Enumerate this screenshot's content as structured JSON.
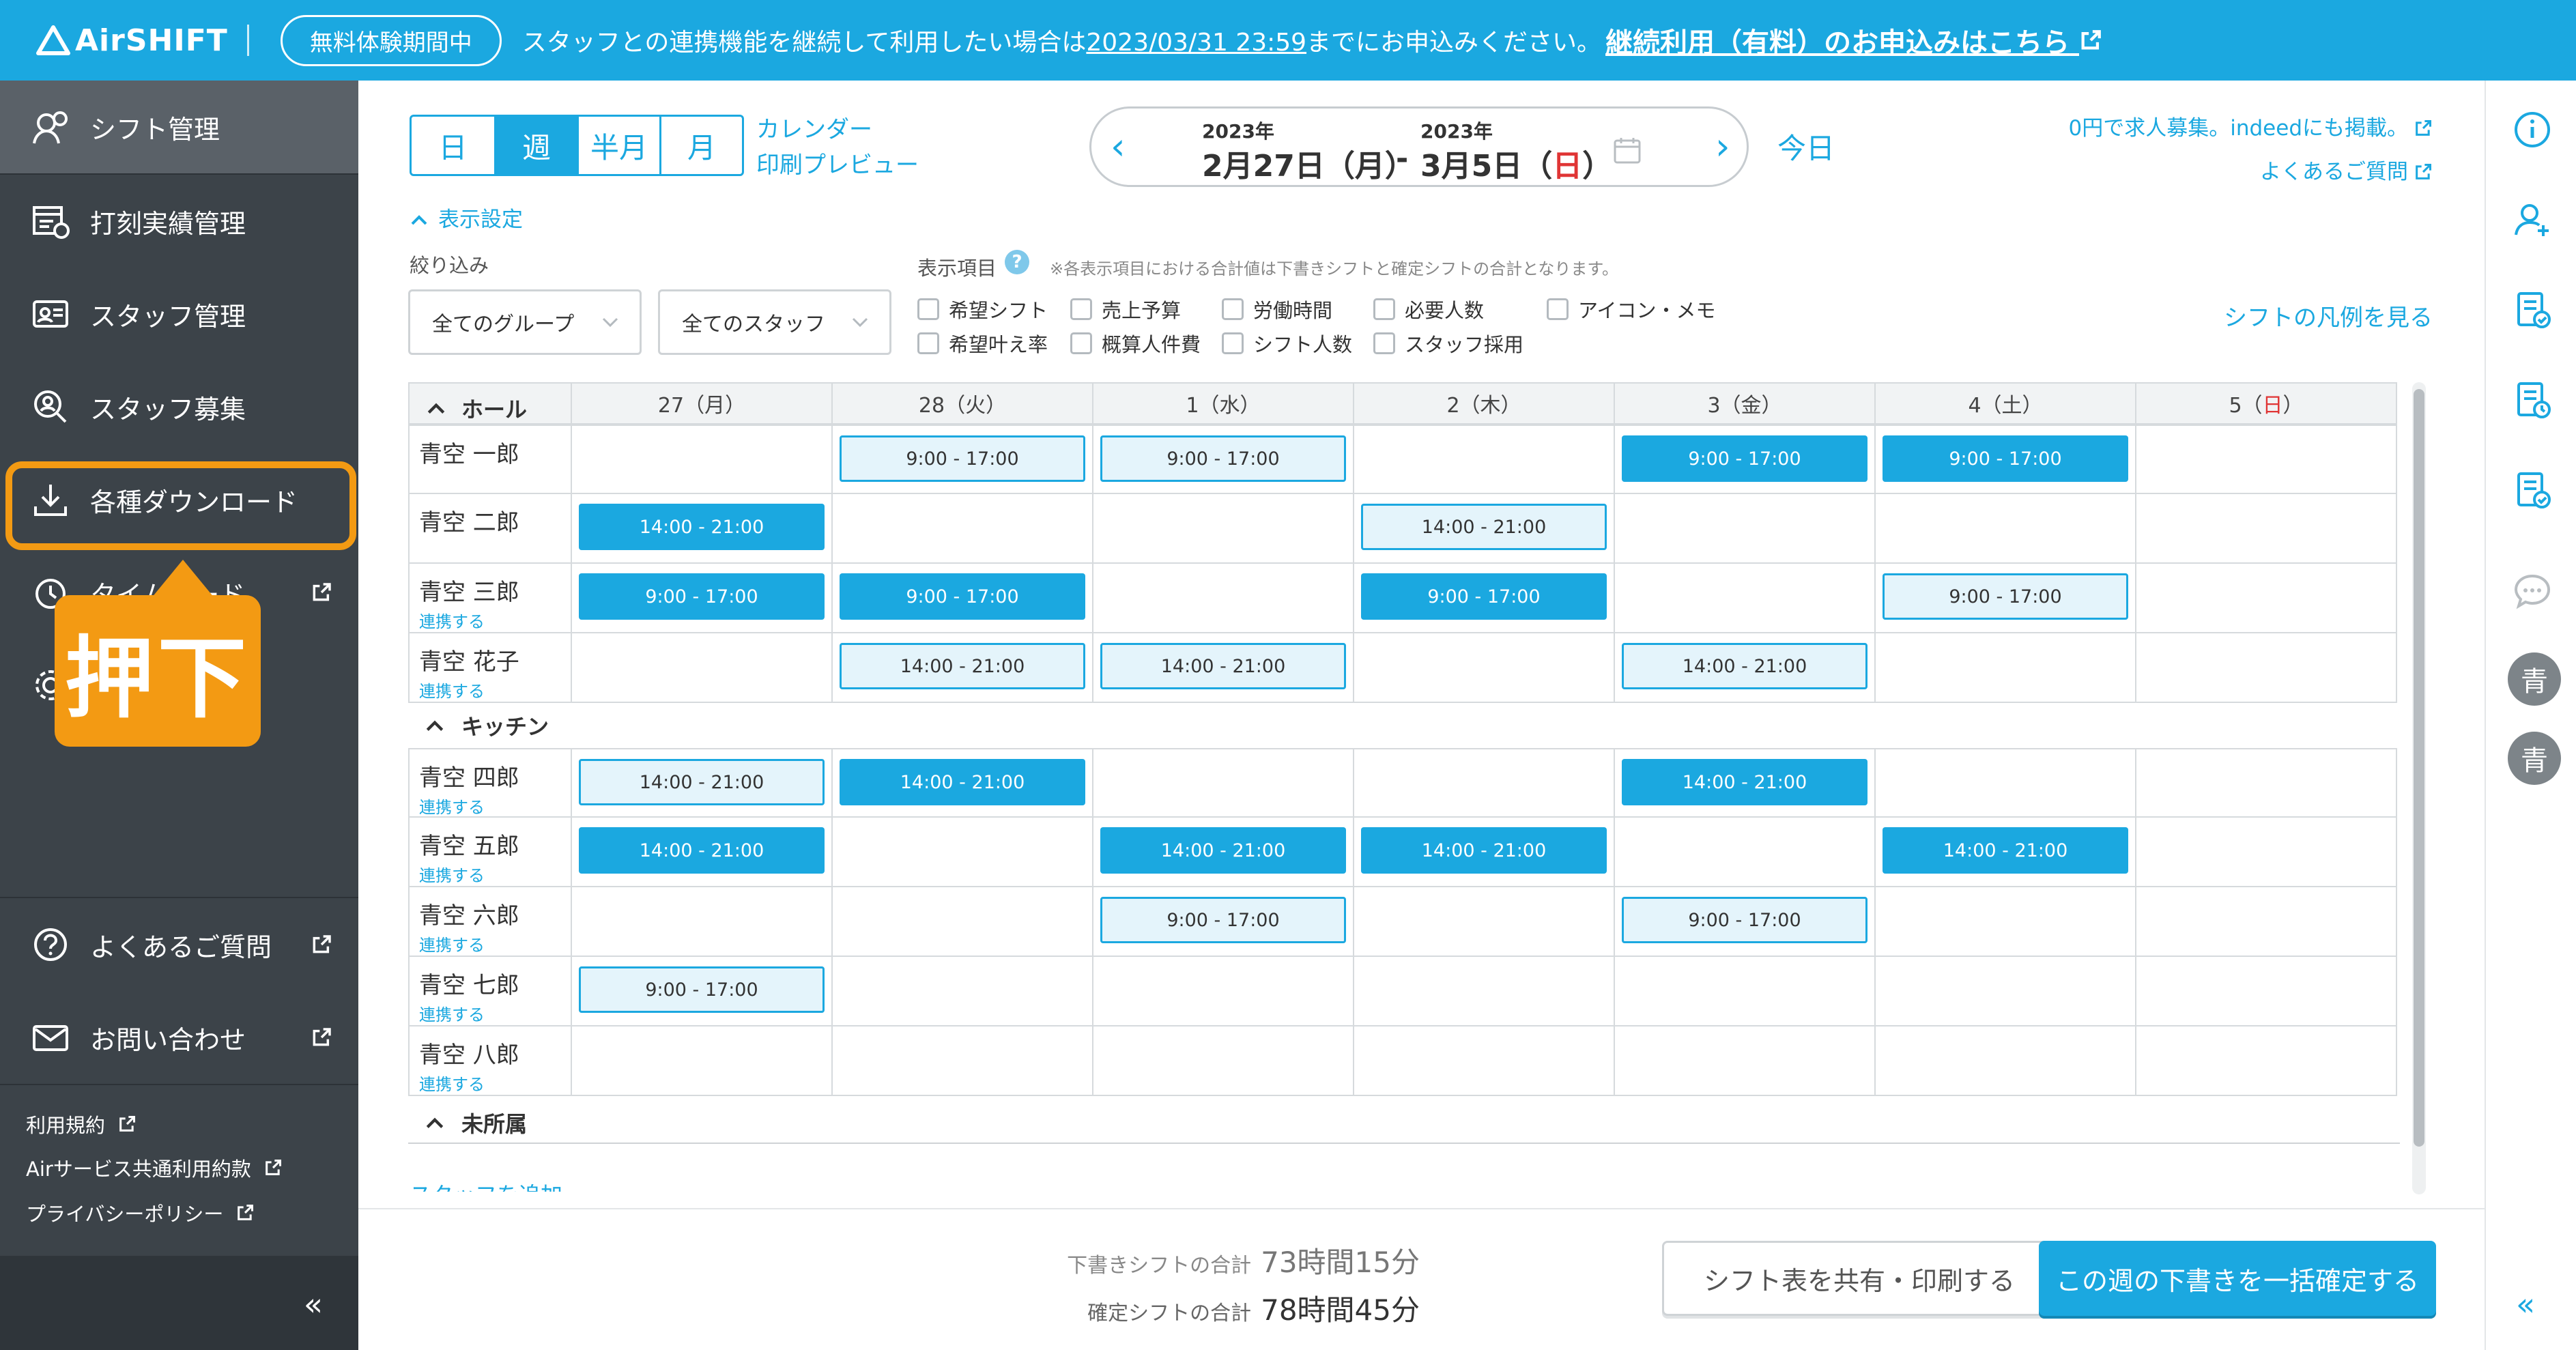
{
  "banner": {
    "logo": "AirSHIFT",
    "trial_badge": "無料体験期間中",
    "message_before": "スタッフとの連携機能を継続して利用したい場合は",
    "deadline": "2023/03/31 23:59",
    "message_after": "までにお申込みください。",
    "cta_link": "継続利用（有料）のお申込みはこちら"
  },
  "sidebar": {
    "items": [
      {
        "label": "シフト管理",
        "icon": "shift-manage-icon"
      },
      {
        "label": "打刻実績管理",
        "icon": "timecard-record-icon"
      },
      {
        "label": "スタッフ管理",
        "icon": "staff-card-icon"
      },
      {
        "label": "スタッフ募集",
        "icon": "staff-search-icon"
      },
      {
        "label": "各種ダウンロード",
        "icon": "download-icon"
      },
      {
        "label": "タイムカード",
        "icon": "timecard-icon"
      }
    ],
    "help_items": [
      {
        "label": "よくあるご質問",
        "icon": "question-icon"
      },
      {
        "label": "お問い合わせ",
        "icon": "mail-icon"
      }
    ],
    "footer_links": [
      "利用規約",
      "Airサービス共通利用約款",
      "プライバシーポリシー"
    ],
    "collapse": "«"
  },
  "callout": {
    "label": "押下",
    "color": "#f39a13"
  },
  "toolbar": {
    "view_modes": [
      "日",
      "週",
      "半月",
      "月"
    ],
    "active_view": "週",
    "calendar_link": "カレンダー",
    "print_preview_link": "印刷プレビュー",
    "start_year": "2023年",
    "start_date": "2月27日（月）",
    "separator": "-",
    "end_year": "2023年",
    "end_date_prefix": "3月5日（",
    "end_date_day": "日",
    "end_date_suffix": "）",
    "today": "今日",
    "recruit_link": "0円で求人募集。indeedにも掲載。",
    "faq_link": "よくあるご質問"
  },
  "filters": {
    "display_setting": "表示設定",
    "filter_label": "絞り込み",
    "group_select": "全てのグループ",
    "staff_select": "全てのスタッフ",
    "display_items_label": "表示項目",
    "note": "※各表示項目における合計値は下書きシフトと確定シフトの合計となります。",
    "checkboxes_row1": [
      "希望シフト",
      "売上予算",
      "労働時間",
      "必要人数",
      "アイコン・メモ"
    ],
    "checkboxes_row2": [
      "希望叶え率",
      "概算人件費",
      "シフト人数",
      "スタッフ採用"
    ],
    "legend_link": "シフトの凡例を見る"
  },
  "schedule": {
    "days": [
      "27（月）",
      "28（火）",
      "1（水）",
      "2（木）",
      "3（金）",
      "4（土）"
    ],
    "sunday": {
      "prefix": "5（",
      "day": "日",
      "suffix": "）"
    },
    "link_label": "連携する",
    "groups": [
      {
        "name": "ホール",
        "staff": [
          {
            "name": "青空 一郎",
            "linked": false,
            "shifts": [
              null,
              {
                "t": "9:00 - 17:00",
                "s": "draft"
              },
              {
                "t": "9:00 - 17:00",
                "s": "draft"
              },
              null,
              {
                "t": "9:00 - 17:00",
                "s": "fixed"
              },
              {
                "t": "9:00 - 17:00",
                "s": "fixed"
              },
              null
            ]
          },
          {
            "name": "青空 二郎",
            "linked": false,
            "shifts": [
              {
                "t": "14:00 - 21:00",
                "s": "fixed"
              },
              null,
              null,
              {
                "t": "14:00 - 21:00",
                "s": "draft"
              },
              null,
              null,
              null
            ]
          },
          {
            "name": "青空 三郎",
            "linked": true,
            "shifts": [
              {
                "t": "9:00 - 17:00",
                "s": "fixed"
              },
              {
                "t": "9:00 - 17:00",
                "s": "fixed"
              },
              null,
              {
                "t": "9:00 - 17:00",
                "s": "fixed"
              },
              null,
              {
                "t": "9:00 - 17:00",
                "s": "draft"
              },
              null
            ]
          },
          {
            "name": "青空 花子",
            "linked": true,
            "shifts": [
              null,
              {
                "t": "14:00 - 21:00",
                "s": "draft"
              },
              {
                "t": "14:00 - 21:00",
                "s": "draft"
              },
              null,
              {
                "t": "14:00 - 21:00",
                "s": "draft"
              },
              null,
              null
            ]
          }
        ]
      },
      {
        "name": "キッチン",
        "staff": [
          {
            "name": "青空 四郎",
            "linked": true,
            "shifts": [
              {
                "t": "14:00 - 21:00",
                "s": "draft"
              },
              {
                "t": "14:00 - 21:00",
                "s": "fixed"
              },
              null,
              null,
              {
                "t": "14:00 - 21:00",
                "s": "fixed"
              },
              null,
              null
            ]
          },
          {
            "name": "青空 五郎",
            "linked": true,
            "shifts": [
              {
                "t": "14:00 - 21:00",
                "s": "fixed"
              },
              null,
              {
                "t": "14:00 - 21:00",
                "s": "fixed"
              },
              {
                "t": "14:00 - 21:00",
                "s": "fixed"
              },
              null,
              {
                "t": "14:00 - 21:00",
                "s": "fixed"
              },
              null
            ]
          },
          {
            "name": "青空 六郎",
            "linked": true,
            "shifts": [
              null,
              null,
              {
                "t": "9:00 - 17:00",
                "s": "draft"
              },
              null,
              {
                "t": "9:00 - 17:00",
                "s": "draft"
              },
              null,
              null
            ]
          },
          {
            "name": "青空 七郎",
            "linked": true,
            "shifts": [
              {
                "t": "9:00 - 17:00",
                "s": "draft"
              },
              null,
              null,
              null,
              null,
              null,
              null
            ]
          },
          {
            "name": "青空 八郎",
            "linked": true,
            "shifts": [
              null,
              null,
              null,
              null,
              null,
              null,
              null
            ]
          }
        ]
      }
    ],
    "unassigned_group": "未所属",
    "add_staff": "スタッフを追加"
  },
  "footer": {
    "draft_total_label": "下書きシフトの合計",
    "draft_total_value": "73時間15分",
    "fixed_total_label": "確定シフトの合計",
    "fixed_total_value": "78時間45分",
    "share_button": "シフト表を共有・印刷する",
    "confirm_button": "この週の下書きを一括確定する"
  },
  "right_rail": {
    "icons": [
      "info-icon",
      "add-user-icon",
      "doc-check-icon",
      "doc-time-icon",
      "doc-user-icon",
      "chat-icon"
    ],
    "avatars": [
      "青",
      "青"
    ],
    "collapse": "«"
  },
  "colors": {
    "brand": "#1ba8e0",
    "sidebar": "#3c4349",
    "accent": "#f39a13",
    "sunday": "#e03535"
  }
}
